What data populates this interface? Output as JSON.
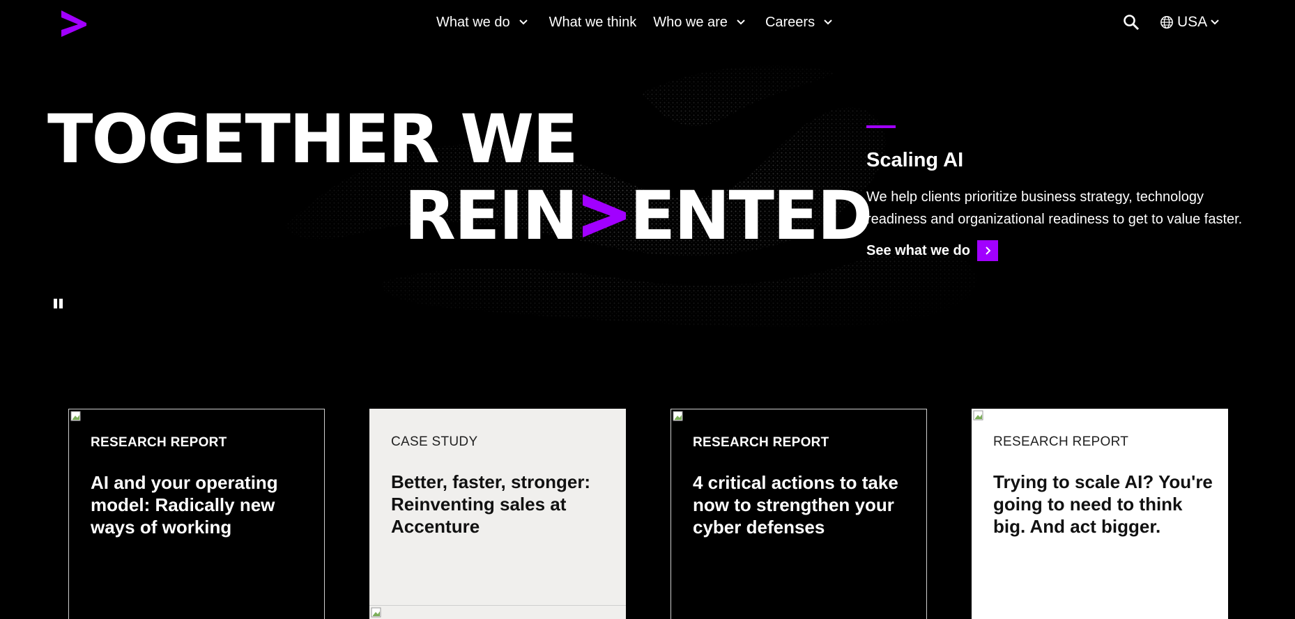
{
  "colors": {
    "accent": "#a100ff",
    "background": "#000000",
    "light_card": "#f0efed"
  },
  "nav": {
    "logo_icon": "accenture-greater-than-logo",
    "items": [
      {
        "label": "What we do",
        "has_dropdown": true
      },
      {
        "label": "What we think",
        "has_dropdown": false
      },
      {
        "label": "Who we are",
        "has_dropdown": true
      },
      {
        "label": "Careers",
        "has_dropdown": true
      }
    ],
    "search_icon": "search-icon",
    "country": {
      "label": "USA",
      "icon": "globe-icon"
    }
  },
  "hero": {
    "headline_line1": "TOGETHER WE",
    "headline_line2_before": "REIN",
    "headline_line2_after": "ENTED",
    "feature": {
      "title": "Scaling AI",
      "text": "We help clients prioritize business strategy, technology readiness and organizational readiness to get to value faster.",
      "link_label": "See what we do"
    },
    "pause_icon": "pause-icon"
  },
  "cards": [
    {
      "type": "RESEARCH REPORT",
      "title": "AI and your operating model: Radically new ways of working"
    },
    {
      "type": "CASE STUDY",
      "title": "Better, faster, stronger: Reinventing sales at Accenture"
    },
    {
      "type": "RESEARCH REPORT",
      "title": "4 critical actions to take now to strengthen your cyber defenses"
    },
    {
      "type": "RESEARCH REPORT",
      "title": "Trying to scale AI? You're going to need to think big. And act bigger."
    }
  ]
}
